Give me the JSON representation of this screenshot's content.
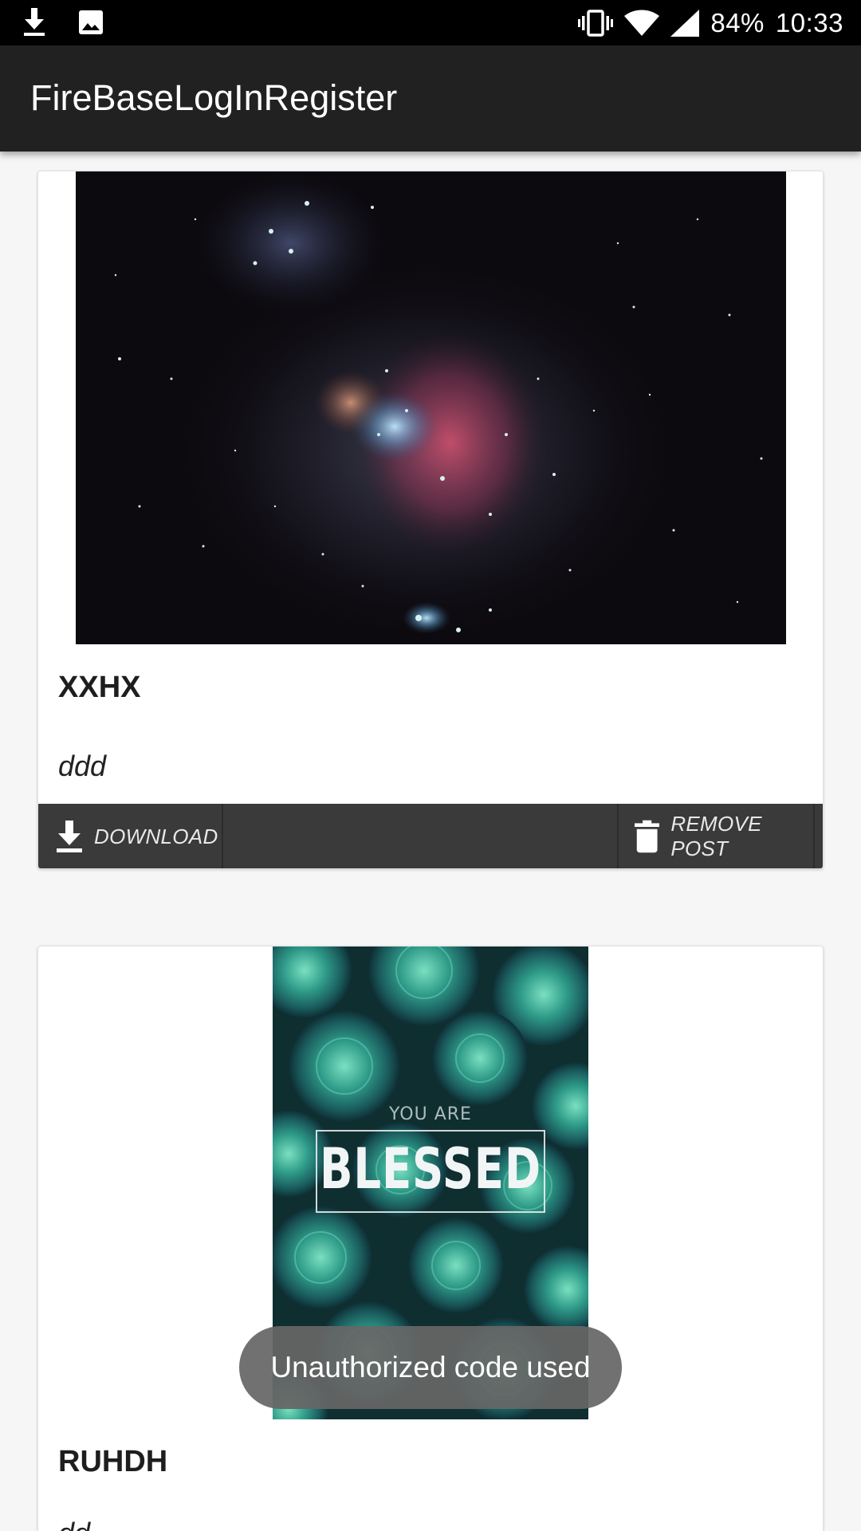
{
  "status_bar": {
    "icons_left": [
      "download-icon",
      "image-icon"
    ],
    "icons_right": [
      "vibrate-icon",
      "wifi-icon",
      "cell-signal-icon"
    ],
    "battery": "84%",
    "time": "10:33"
  },
  "app_bar": {
    "title": "FireBaseLogInRegister"
  },
  "posts": [
    {
      "image_icon": "nebula-image",
      "title": "XXHX",
      "description": "ddd",
      "download_label": "DOWNLOAD",
      "remove_label": "REMOVE POST"
    },
    {
      "image_icon": "succulent-poster-image",
      "poster_small": "YOU ARE",
      "poster_big": "BLESSED",
      "title": "RUHDH"
    }
  ],
  "toast": {
    "message": "Unauthorized code used"
  },
  "colors": {
    "status_bar": "#000000",
    "app_bar": "#212121",
    "background": "#f6f6f6",
    "action_bar": "#3a3a3a",
    "toast": "#666666"
  }
}
